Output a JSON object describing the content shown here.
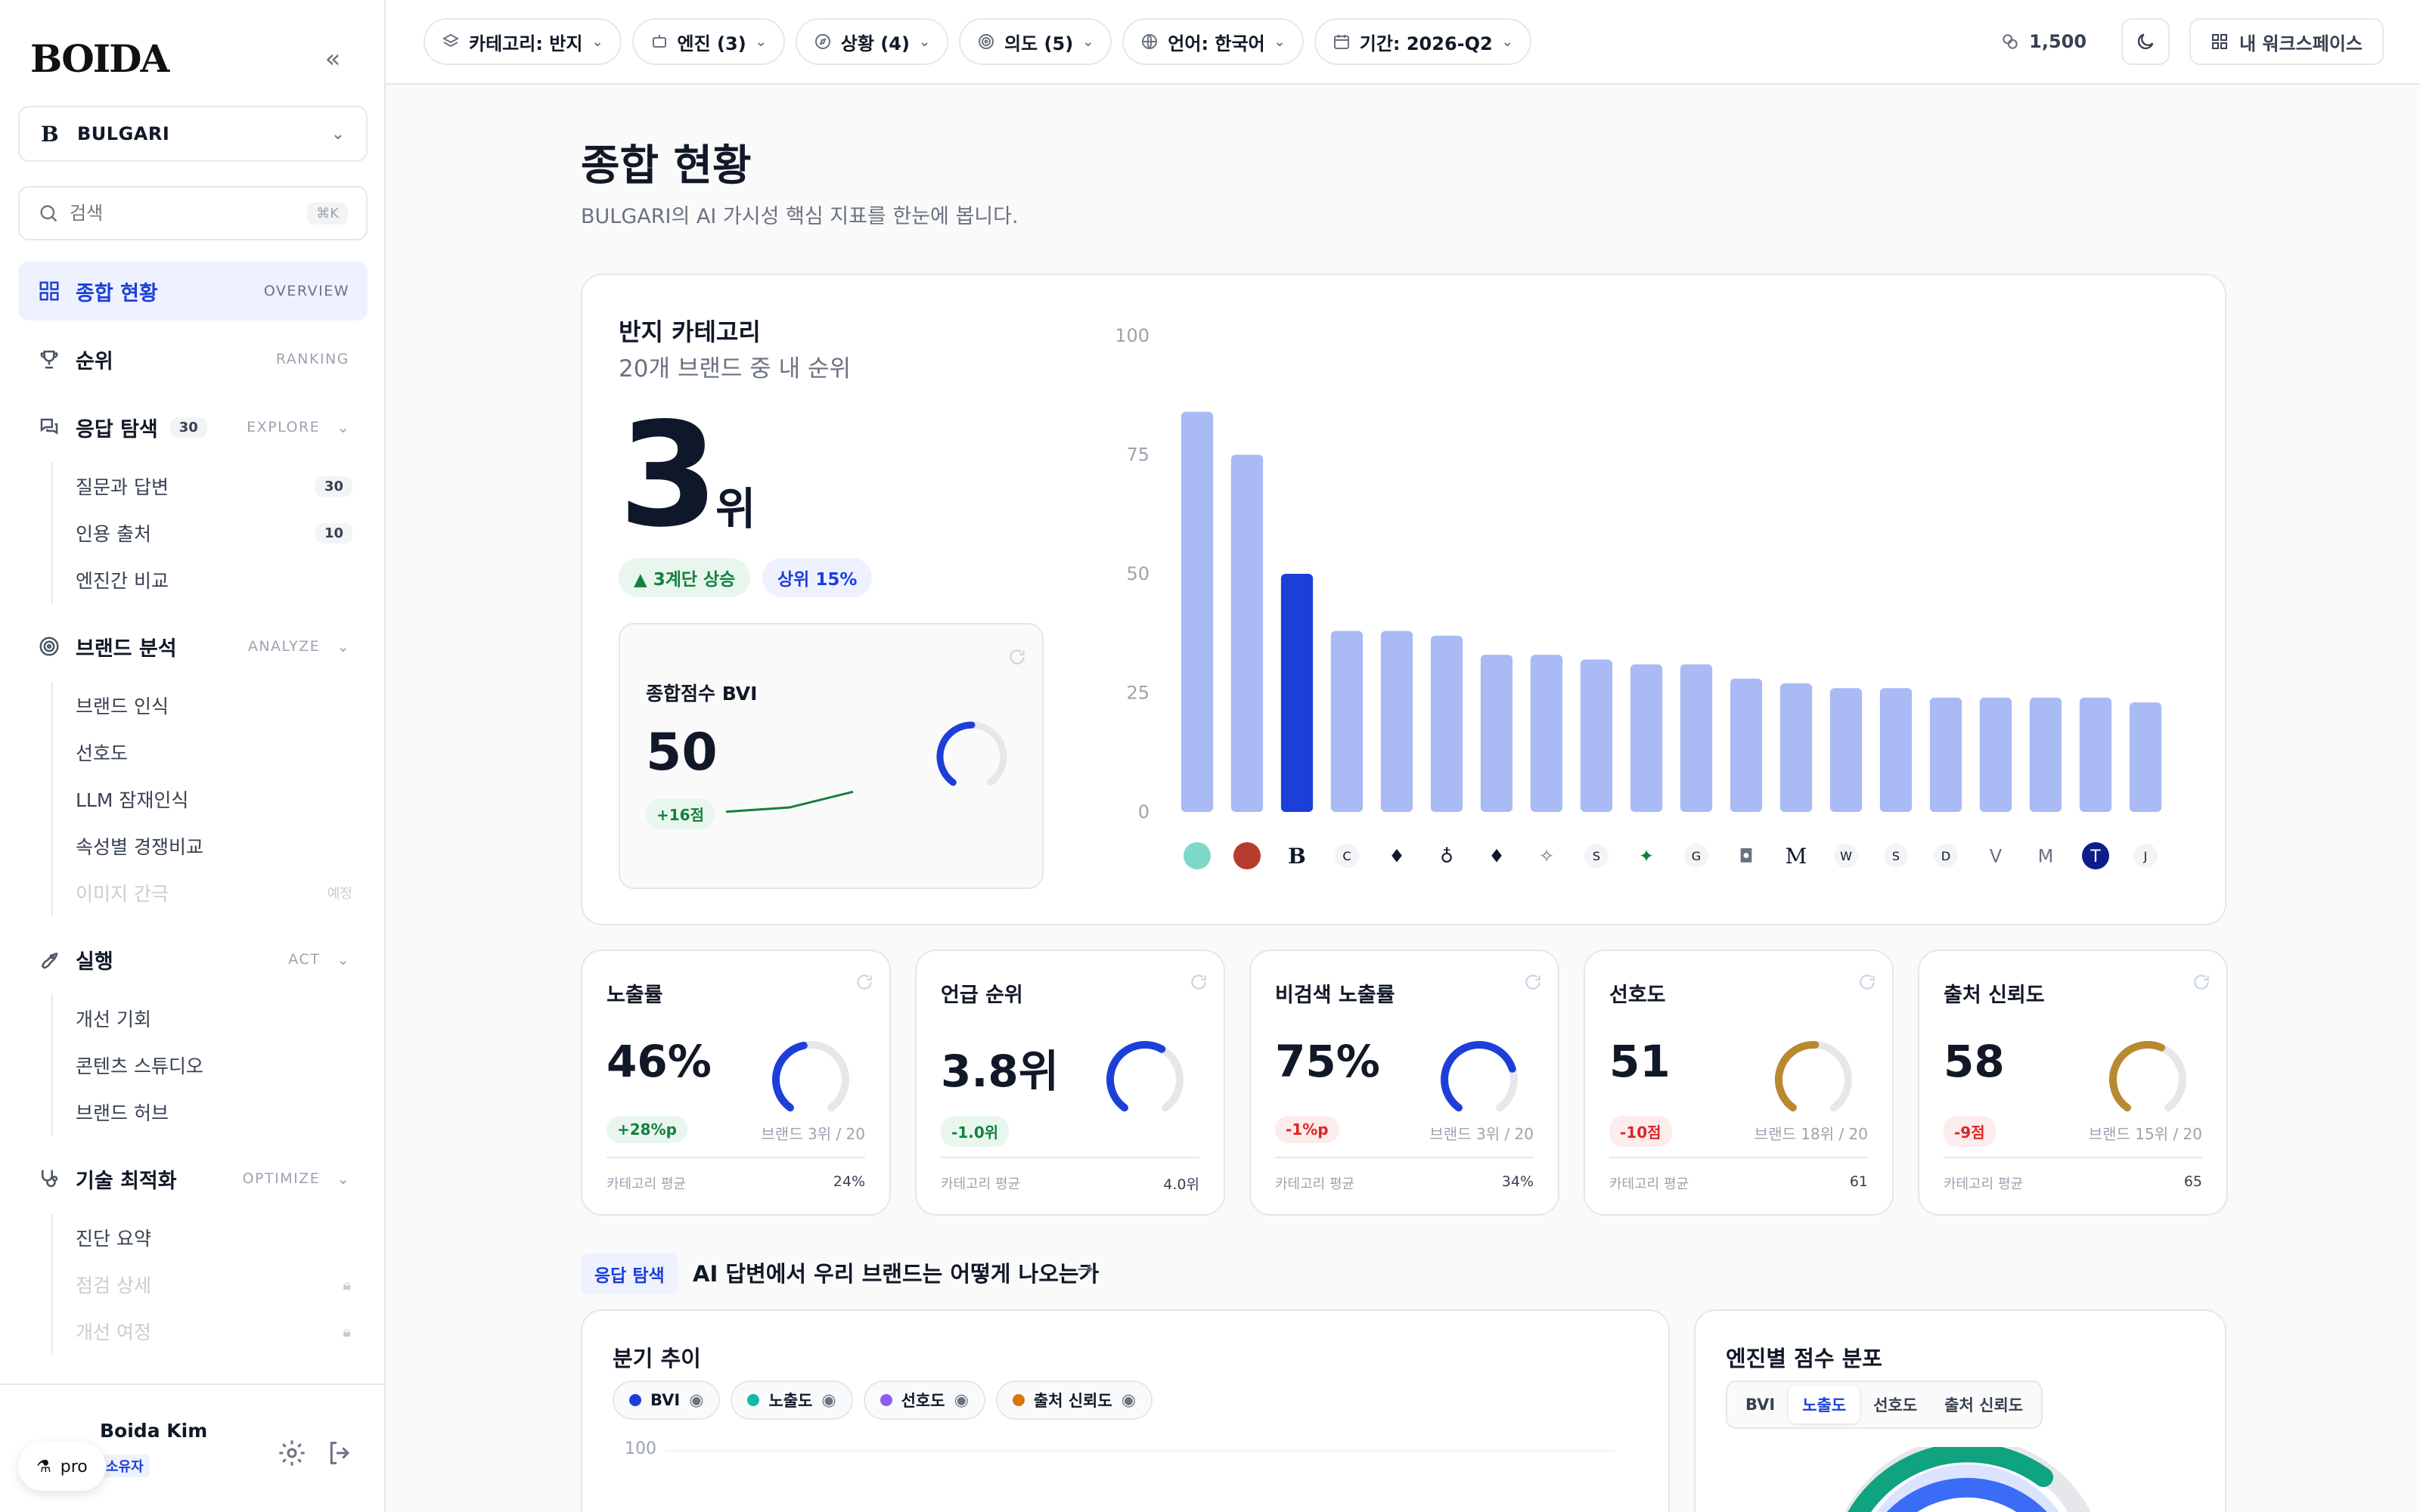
{
  "sidebar": {
    "logo": "BOIDA",
    "brand": {
      "mark": "B",
      "name": "BULGARI"
    },
    "search": {
      "placeholder": "검색",
      "shortcut": "⌘K"
    },
    "nav": [
      {
        "label": "종합 현황",
        "tag": "OVERVIEW",
        "active": true,
        "icon": "grid-icon"
      },
      {
        "label": "순위",
        "tag": "RANKING",
        "icon": "trophy-icon"
      },
      {
        "label": "응답 탐색",
        "count": "30",
        "tag": "EXPLORE",
        "icon": "chat-icon",
        "children": [
          {
            "label": "질문과 답변",
            "count": "30"
          },
          {
            "label": "인용 출처",
            "count": "10"
          },
          {
            "label": "엔진간 비교"
          }
        ]
      },
      {
        "label": "브랜드 분석",
        "tag": "ANALYZE",
        "icon": "target-icon",
        "children": [
          {
            "label": "브랜드 인식"
          },
          {
            "label": "선호도"
          },
          {
            "label": "LLM 잠재인식"
          },
          {
            "label": "속성별 경쟁비교"
          },
          {
            "label": "이미지 간극",
            "note": "예정",
            "disabled": true
          }
        ]
      },
      {
        "label": "실행",
        "tag": "ACT",
        "icon": "rocket-icon",
        "children": [
          {
            "label": "개선 기회"
          },
          {
            "label": "콘텐츠 스튜디오"
          },
          {
            "label": "브랜드 허브"
          }
        ]
      },
      {
        "label": "기술 최적화",
        "tag": "OPTIMIZE",
        "icon": "stethoscope-icon",
        "children": [
          {
            "label": "진단 요약"
          },
          {
            "label": "점검 상세",
            "locked": true,
            "disabled": true
          },
          {
            "label": "개선 여정",
            "locked": true,
            "disabled": true
          }
        ]
      }
    ],
    "user": {
      "name": "Boida Kim",
      "role": "소유자",
      "plan": "pro"
    }
  },
  "topbar": {
    "filters": [
      {
        "label": "카테고리: 반지",
        "icon": "layers-icon"
      },
      {
        "label": "엔진 (3)",
        "icon": "bot-icon"
      },
      {
        "label": "상황 (4)",
        "icon": "compass-icon"
      },
      {
        "label": "의도 (5)",
        "icon": "target-icon"
      },
      {
        "label": "언어: 한국어",
        "icon": "globe-icon"
      },
      {
        "label": "기간: 2026-Q2",
        "icon": "calendar-icon"
      }
    ],
    "credits": "1,500",
    "workspace": "내 워크스페이스"
  },
  "page": {
    "title": "종합 현황",
    "subtitle": "BULGARI의 AI 가시성 핵심 지표를 한눈에 봅니다."
  },
  "rank_card": {
    "title": "반지 카테고리",
    "subtitle": "20개 브랜드 중 내 순위",
    "rank": "3",
    "rank_unit": "위",
    "change": "▲ 3계단 상승",
    "percentile": "상위 15%",
    "bvi": {
      "title": "종합점수 BVI",
      "value": "50",
      "delta": "+16점",
      "gauge": 0.5,
      "trend": [
        30,
        36,
        58
      ]
    }
  },
  "chart_data": {
    "type": "bar",
    "ylim": [
      0,
      100
    ],
    "yticks": [
      0,
      25,
      50,
      75,
      100
    ],
    "highlight_index": 2,
    "values": [
      84,
      75,
      50,
      38,
      38,
      37,
      33,
      33,
      32,
      31,
      31,
      28,
      27,
      26,
      26,
      24,
      24,
      24,
      24,
      23
    ],
    "icons": [
      "●",
      "●",
      "B",
      "C",
      "♦",
      "♁",
      "♦",
      "✧",
      "S",
      "✦",
      "G",
      "◘",
      "M",
      "W",
      "S",
      "D",
      "V",
      "M",
      "T",
      "J"
    ],
    "icon_styles": [
      "teal",
      "red",
      "serif",
      "circle",
      "gem",
      "ring",
      "gem",
      "plain",
      "circle",
      "green",
      "circle",
      "plain",
      "script",
      "circle",
      "circle",
      "circle",
      "plain",
      "plain",
      "navy",
      "circle"
    ]
  },
  "metrics": [
    {
      "title": "노출률",
      "value": "46%",
      "delta": "+28%p",
      "delta_dir": "pos",
      "rank": "브랜드 3위 / 20",
      "avg_label": "카테고리 평균",
      "avg": "24%",
      "gauge": 0.46,
      "color": "#1d3fd9"
    },
    {
      "title": "언급 순위",
      "value": "3.8위",
      "delta": "-1.0위",
      "delta_dir": "pos",
      "rank": "",
      "avg_label": "카테고리 평균",
      "avg": "4.0위",
      "gauge": 0.6,
      "color": "#1d3fd9"
    },
    {
      "title": "비검색 노출률",
      "value": "75%",
      "delta": "-1%p",
      "delta_dir": "neg",
      "rank": "브랜드 3위 / 20",
      "avg_label": "카테고리 평균",
      "avg": "34%",
      "gauge": 0.75,
      "color": "#1d3fd9"
    },
    {
      "title": "선호도",
      "value": "51",
      "delta": "-10점",
      "delta_dir": "neg",
      "rank": "브랜드 18위 / 20",
      "avg_label": "카테고리 평균",
      "avg": "61",
      "gauge": 0.51,
      "color": "#b8892e"
    },
    {
      "title": "출처 신뢰도",
      "value": "58",
      "delta": "-9점",
      "delta_dir": "neg",
      "rank": "브랜드 15위 / 20",
      "avg_label": "카테고리 평균",
      "avg": "65",
      "gauge": 0.58,
      "color": "#b8892e"
    }
  ],
  "explore": {
    "tag": "응답 탐색",
    "title": "AI 답변에서 우리 브랜드는 어떻게 나오는가",
    "arrow": "→"
  },
  "trend": {
    "title": "분기 추이",
    "legend": [
      {
        "label": "BVI",
        "color": "#1d3fd9"
      },
      {
        "label": "노출도",
        "color": "#14b8a6"
      },
      {
        "label": "선호도",
        "color": "#8b5cf6"
      },
      {
        "label": "출처 신뢰도",
        "color": "#d97706"
      }
    ],
    "axis_top": "100"
  },
  "engine": {
    "title": "엔진별 점수 분포",
    "tabs": [
      "BVI",
      "노출도",
      "선호도",
      "출처 신뢰도"
    ],
    "active_tab": 1
  }
}
